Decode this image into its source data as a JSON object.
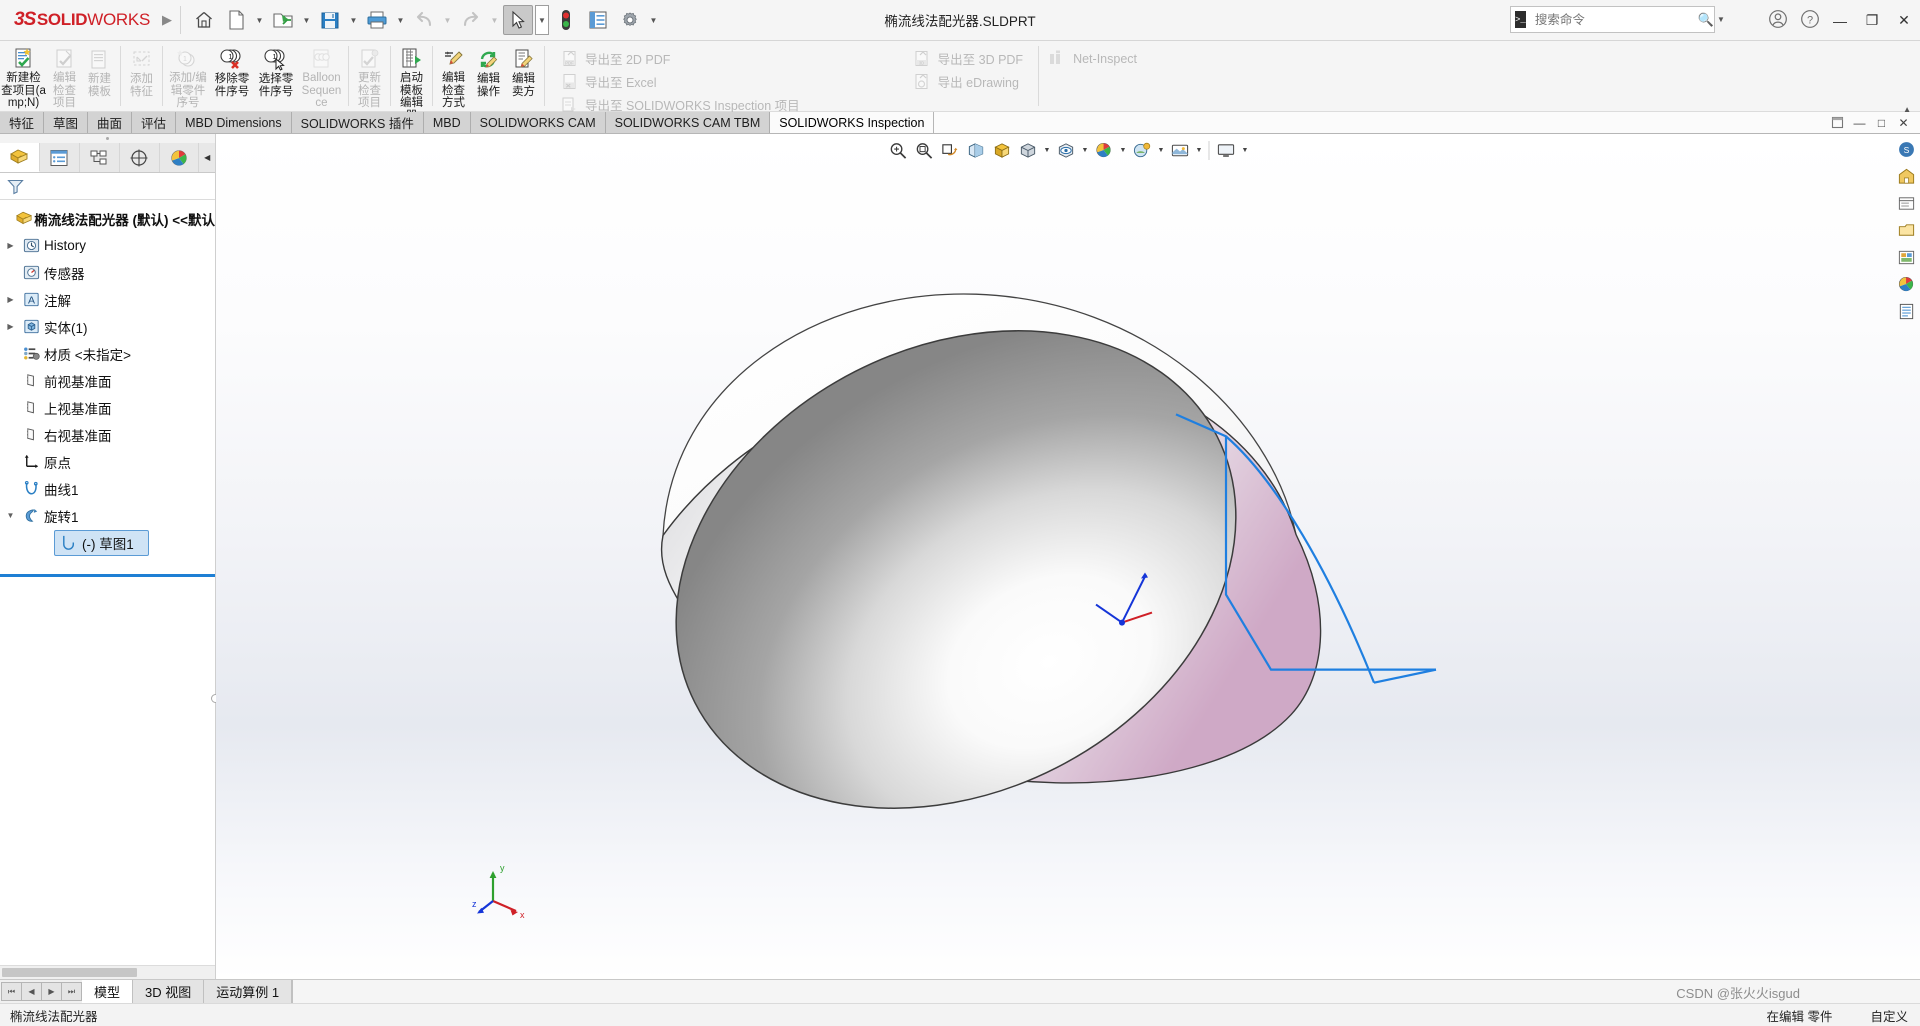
{
  "window": {
    "title": "椭流线法配光器.SLDPRT",
    "brand_ds": "3S",
    "brand_solid": "SOLID",
    "brand_works": "WORKS",
    "minimize": "—",
    "maximize": "❐",
    "close": "✕"
  },
  "search": {
    "placeholder": "搜索命令",
    "prompt": ">_"
  },
  "quick_access": [
    {
      "name": "home-icon",
      "label": "主页"
    },
    {
      "name": "new-document-icon",
      "label": "新建"
    },
    {
      "name": "open-icon",
      "label": "打开"
    },
    {
      "name": "save-icon",
      "label": "保存"
    },
    {
      "name": "print-icon",
      "label": "打印"
    },
    {
      "name": "undo-icon",
      "label": "撤消"
    },
    {
      "name": "redo-icon",
      "label": "重做"
    },
    {
      "name": "select-cursor-icon",
      "label": "选择"
    },
    {
      "name": "rebuild-icon",
      "label": "重建模型"
    },
    {
      "name": "options-panel-icon",
      "label": "选项面板"
    },
    {
      "name": "settings-gear-icon",
      "label": "选项"
    }
  ],
  "ribbon": {
    "buttons": [
      {
        "label": "新建检查项目(amp;N)",
        "enabled": true,
        "icon": "new-inspection-project-icon"
      },
      {
        "label": "编辑检查项目",
        "enabled": false,
        "icon": "edit-inspection-icon"
      },
      {
        "label": "新建模板",
        "enabled": false,
        "icon": "new-template-icon"
      },
      {
        "label": "添加特征",
        "enabled": false,
        "icon": "add-feature-icon"
      },
      {
        "label": "添加/编辑零件序号",
        "enabled": false,
        "icon": "add-balloon-icon"
      },
      {
        "label": "移除零件序号",
        "enabled": true,
        "icon": "remove-balloon-icon"
      },
      {
        "label": "选择零件序号",
        "enabled": true,
        "icon": "select-balloon-icon"
      },
      {
        "label": "Balloon Sequence",
        "enabled": false,
        "icon": "balloon-sequence-icon"
      },
      {
        "label": "更新检查项目",
        "enabled": false,
        "icon": "update-inspection-icon"
      },
      {
        "label": "启动模板编辑器",
        "enabled": true,
        "icon": "launch-template-editor-icon"
      },
      {
        "label": "编辑检查方式",
        "enabled": true,
        "icon": "edit-inspection-method-icon"
      },
      {
        "label": "编辑操作",
        "enabled": true,
        "icon": "edit-operation-icon"
      },
      {
        "label": "编辑卖方",
        "enabled": true,
        "icon": "edit-vendor-icon"
      }
    ],
    "export_col1": [
      {
        "label": "导出至 2D PDF",
        "icon": "export-pdf-icon"
      },
      {
        "label": "导出至 Excel",
        "icon": "export-excel-icon"
      },
      {
        "label": "导出至 SOLIDWORKS Inspection 项目",
        "icon": "export-swinspection-icon"
      }
    ],
    "export_col2": [
      {
        "label": "导出至 3D PDF",
        "icon": "export-3dpdf-icon"
      },
      {
        "label": "导出 eDrawing",
        "icon": "export-edrawing-icon"
      }
    ],
    "net_inspect": {
      "label": "Net-Inspect",
      "icon": "net-inspect-icon"
    }
  },
  "tabs": {
    "items": [
      {
        "label": "特征",
        "active": false
      },
      {
        "label": "草图",
        "active": false
      },
      {
        "label": "曲面",
        "active": false
      },
      {
        "label": "评估",
        "active": false
      },
      {
        "label": "MBD Dimensions",
        "active": false
      },
      {
        "label": "SOLIDWORKS 插件",
        "active": false
      },
      {
        "label": "MBD",
        "active": false
      },
      {
        "label": "SOLIDWORKS CAM",
        "active": false
      },
      {
        "label": "SOLIDWORKS CAM TBM",
        "active": false
      },
      {
        "label": "SOLIDWORKS Inspection",
        "active": true
      }
    ],
    "window_controls": [
      "restore-doc-icon",
      "minimize-doc-icon",
      "maximize-doc-icon",
      "close-doc-icon"
    ]
  },
  "left_panel": {
    "tabs": [
      {
        "name": "feature-manager-tab",
        "active": true
      },
      {
        "name": "property-manager-tab",
        "active": false
      },
      {
        "name": "configuration-manager-tab",
        "active": false
      },
      {
        "name": "dimxpert-manager-tab",
        "active": false
      },
      {
        "name": "display-manager-tab",
        "active": false
      }
    ],
    "filter_icon": "filter-funnel-icon",
    "tree": [
      {
        "label": "椭流线法配光器 (默认) <<默认",
        "icon": "part-icon",
        "indent": 0,
        "expander": "",
        "root": true
      },
      {
        "label": "History",
        "icon": "history-icon",
        "indent": 1,
        "expander": "▶"
      },
      {
        "label": "传感器",
        "icon": "sensors-icon",
        "indent": 1,
        "expander": ""
      },
      {
        "label": "注解",
        "icon": "annotations-icon",
        "indent": 1,
        "expander": "▶"
      },
      {
        "label": "实体(1)",
        "icon": "solid-bodies-icon",
        "indent": 1,
        "expander": "▶"
      },
      {
        "label": "材质 <未指定>",
        "icon": "material-icon",
        "indent": 1,
        "expander": ""
      },
      {
        "label": "前视基准面",
        "icon": "plane-icon",
        "indent": 1,
        "expander": ""
      },
      {
        "label": "上视基准面",
        "icon": "plane-icon",
        "indent": 1,
        "expander": ""
      },
      {
        "label": "右视基准面",
        "icon": "plane-icon",
        "indent": 1,
        "expander": ""
      },
      {
        "label": "原点",
        "icon": "origin-icon",
        "indent": 1,
        "expander": ""
      },
      {
        "label": "曲线1",
        "icon": "curve-icon",
        "indent": 1,
        "expander": ""
      },
      {
        "label": "旋转1",
        "icon": "revolve-icon",
        "indent": 1,
        "expander": "▼"
      },
      {
        "label": "(-) 草图1",
        "icon": "sketch-icon",
        "indent": 2,
        "expander": "",
        "selected": true
      }
    ]
  },
  "view_toolbar": [
    {
      "name": "zoom-to-fit-icon",
      "caret": false
    },
    {
      "name": "zoom-to-area-icon",
      "caret": false
    },
    {
      "name": "previous-view-icon",
      "caret": false
    },
    {
      "name": "section-view-icon",
      "caret": false
    },
    {
      "name": "view-orientation-icon",
      "caret": false
    },
    {
      "name": "display-style-icon",
      "caret": true
    },
    {
      "name": "hide-show-items-icon",
      "caret": true
    },
    {
      "name": "edit-appearance-icon",
      "caret": true
    },
    {
      "name": "apply-scene-icon",
      "caret": true
    },
    {
      "name": "view-settings-icon",
      "caret": true
    },
    {
      "name": "viewport-layout-icon",
      "caret": true
    }
  ],
  "right_toolbar": [
    {
      "name": "solidworks-resources-icon"
    },
    {
      "name": "design-library-icon"
    },
    {
      "name": "file-explorer-icon"
    },
    {
      "name": "view-palette-icon"
    },
    {
      "name": "appearances-scenes-icon"
    },
    {
      "name": "custom-properties-icon"
    }
  ],
  "triad": {
    "x_label": "x",
    "y_label": "y",
    "z_label": "z"
  },
  "bottom_tabs": {
    "nav": [
      "⏮",
      "◀",
      "▶",
      "⏭"
    ],
    "items": [
      {
        "label": "模型",
        "active": true
      },
      {
        "label": "3D 视图",
        "active": false
      },
      {
        "label": "运动算例 1",
        "active": false
      }
    ]
  },
  "status_bar": {
    "left": "椭流线法配光器",
    "editing": "在编辑 零件",
    "custom": "自定义"
  },
  "watermark": "CSDN @张火火isgud"
}
